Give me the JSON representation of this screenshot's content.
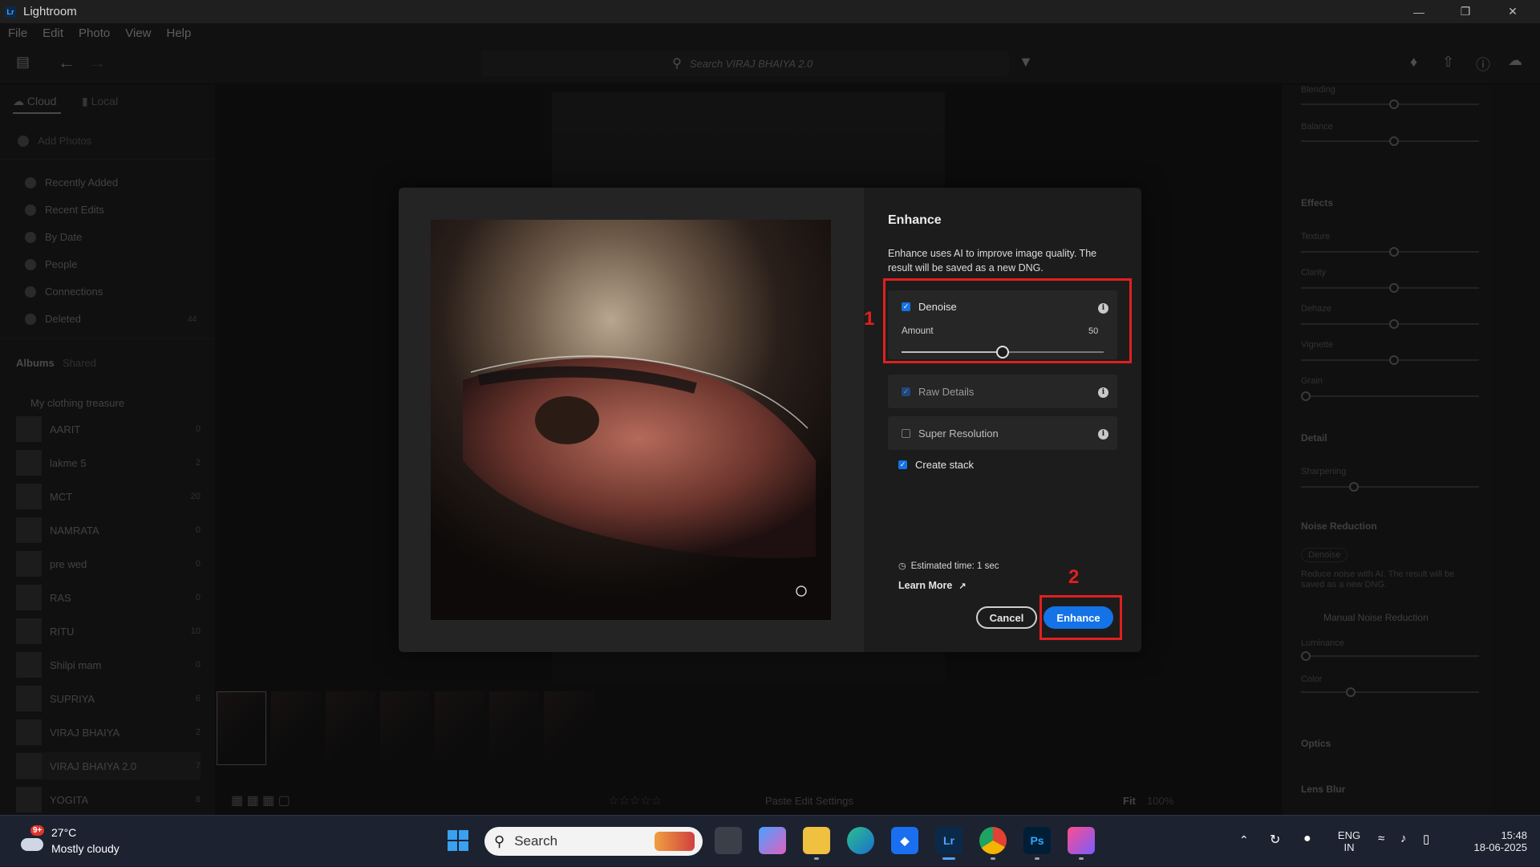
{
  "window": {
    "title": "Lightroom",
    "logo": "Lr"
  },
  "menu": [
    "File",
    "Edit",
    "Photo",
    "View",
    "Help"
  ],
  "search": {
    "placeholder": "Search VIRAJ BHAIYA 2.0"
  },
  "left_panel": {
    "tabs": [
      "Cloud",
      "Local"
    ],
    "add_photos": "Add Photos",
    "nav": [
      {
        "label": "Recently Added",
        "icon": "clock-icon"
      },
      {
        "label": "Recent Edits",
        "icon": "edit-icon"
      },
      {
        "label": "By Date",
        "icon": "calendar-icon"
      },
      {
        "label": "People",
        "icon": "person-icon"
      },
      {
        "label": "Connections",
        "icon": "connections-icon"
      },
      {
        "label": "Deleted",
        "icon": "trash-icon",
        "count": "44"
      }
    ],
    "album_tabs": [
      "Albums",
      "Shared"
    ],
    "folder": "My clothing treasure",
    "albums": [
      {
        "name": "AARIT",
        "count": "0"
      },
      {
        "name": "lakme 5",
        "count": "2"
      },
      {
        "name": "MCT",
        "count": "20"
      },
      {
        "name": "NAMRATA",
        "count": "0"
      },
      {
        "name": "pre wed",
        "count": "0"
      },
      {
        "name": "RAS",
        "count": "0"
      },
      {
        "name": "RITU",
        "count": "10"
      },
      {
        "name": "Shilpi mam",
        "count": "0"
      },
      {
        "name": "SUPRIYA",
        "count": "6"
      },
      {
        "name": "VIRAJ BHAIYA",
        "count": "2"
      },
      {
        "name": "VIRAJ BHAIYA 2.0",
        "count": "7"
      },
      {
        "name": "YOGITA",
        "count": "8"
      }
    ]
  },
  "bottom_bar": {
    "paste": "Paste Edit Settings",
    "fit": "Fit",
    "zoom": "100%"
  },
  "right_panel": {
    "sliders_top": [
      {
        "label": "Blending",
        "value": "50"
      },
      {
        "label": "Balance",
        "value": "0"
      }
    ],
    "effects_title": "Effects",
    "effects": [
      {
        "label": "Texture",
        "value": "0"
      },
      {
        "label": "Clarity",
        "value": "0"
      },
      {
        "label": "Dehaze",
        "value": "0"
      },
      {
        "label": "Vignette",
        "value": "0"
      },
      {
        "label": "Grain",
        "value": "0"
      }
    ],
    "detail_title": "Detail",
    "sharpening": {
      "label": "Sharpening",
      "value": "40"
    },
    "noise_title": "Noise Reduction",
    "denoise_btn": "Denoise",
    "noise_desc": "Reduce noise with AI. The result will be saved as a new DNG.",
    "manual_nr": "Manual Noise Reduction",
    "luminance": {
      "label": "Luminance",
      "value": "0"
    },
    "color": {
      "label": "Color",
      "value": "25"
    },
    "optics_title": "Optics",
    "lens_blur_title": "Lens Blur"
  },
  "dialog": {
    "title": "Enhance",
    "description": "Enhance uses AI to improve image quality. The result will be saved as a new DNG.",
    "denoise": {
      "label": "Denoise",
      "checked": true,
      "amount_label": "Amount",
      "amount": 50
    },
    "raw_details": {
      "label": "Raw Details",
      "checked": true
    },
    "super_resolution": {
      "label": "Super Resolution",
      "checked": false
    },
    "create_stack": {
      "label": "Create stack",
      "checked": true
    },
    "estimated_time": "Estimated time: 1 sec",
    "learn_more": "Learn More",
    "cancel": "Cancel",
    "enhance": "Enhance",
    "annotations": [
      "1",
      "2"
    ]
  },
  "taskbar": {
    "weather": {
      "temp": "27°C",
      "desc": "Mostly cloudy",
      "badge": "9+"
    },
    "search": "Search",
    "lang": [
      "ENG",
      "IN"
    ],
    "time": "15:48",
    "date": "18-06-2025"
  },
  "colors": {
    "accent": "#1473e6",
    "highlight": "#e02020"
  }
}
